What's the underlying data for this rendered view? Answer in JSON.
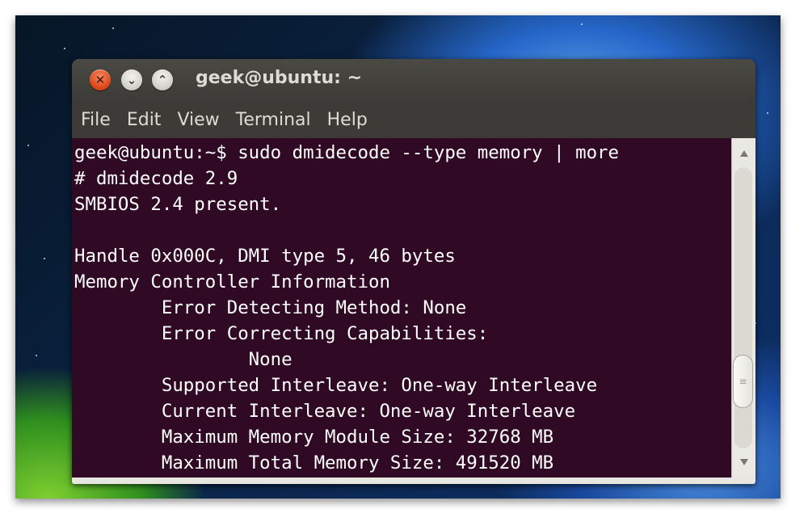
{
  "window": {
    "title": "geek@ubuntu: ~",
    "buttons": {
      "close_glyph": "✕",
      "minimize_glyph": "⌄",
      "maximize_glyph": "⌃"
    },
    "colors": {
      "titlebar": "#3c3b37",
      "close_button": "#df4a1c",
      "terminal_background": "#300a24",
      "terminal_text": "#ffffff"
    }
  },
  "menu": {
    "items": [
      {
        "label": "File"
      },
      {
        "label": "Edit"
      },
      {
        "label": "View"
      },
      {
        "label": "Terminal"
      },
      {
        "label": "Help"
      }
    ]
  },
  "terminal": {
    "lines": [
      "geek@ubuntu:~$ sudo dmidecode --type memory | more",
      "# dmidecode 2.9",
      "SMBIOS 2.4 present.",
      "",
      "Handle 0x000C, DMI type 5, 46 bytes",
      "Memory Controller Information",
      "        Error Detecting Method: None",
      "        Error Correcting Capabilities:",
      "                None",
      "        Supported Interleave: One-way Interleave",
      "        Current Interleave: One-way Interleave",
      "        Maximum Memory Module Size: 32768 MB",
      "        Maximum Total Memory Size: 491520 MB"
    ]
  },
  "scrollbar": {
    "up_icon": "scroll-up-arrow",
    "down_icon": "scroll-down-arrow",
    "thumb_grip": "≡"
  }
}
